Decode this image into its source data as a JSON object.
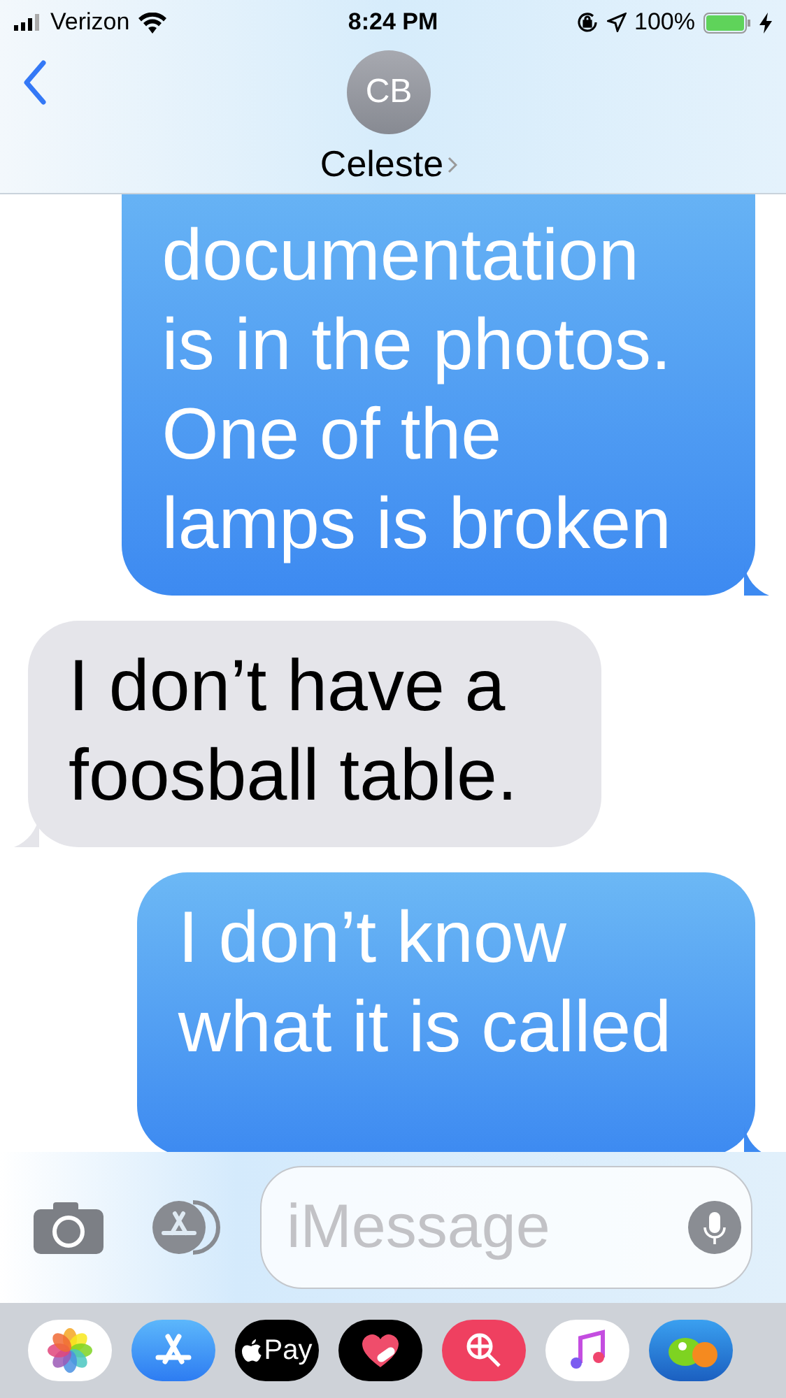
{
  "status_bar": {
    "carrier": "Verizon",
    "time": "8:24 PM",
    "battery": "100%",
    "charging": true
  },
  "header": {
    "avatar_initials": "CB",
    "contact_name": "Celeste"
  },
  "messages": [
    {
      "kind": "sent",
      "lines": [
        "documentation",
        "is in the photos.",
        "One of the",
        "lamps is broken"
      ]
    },
    {
      "kind": "received",
      "lines": [
        "I don’t have a",
        "foosball table."
      ]
    },
    {
      "kind": "sent",
      "lines": [
        "I don’t know",
        "what it is called"
      ]
    }
  ],
  "composer": {
    "placeholder": "iMessage"
  },
  "app_drawer": [
    {
      "kind": "photos"
    },
    {
      "kind": "appstore"
    },
    {
      "kind": "pay",
      "label": "Pay"
    },
    {
      "kind": "heart"
    },
    {
      "kind": "search"
    },
    {
      "kind": "music"
    },
    {
      "kind": "game"
    }
  ]
}
